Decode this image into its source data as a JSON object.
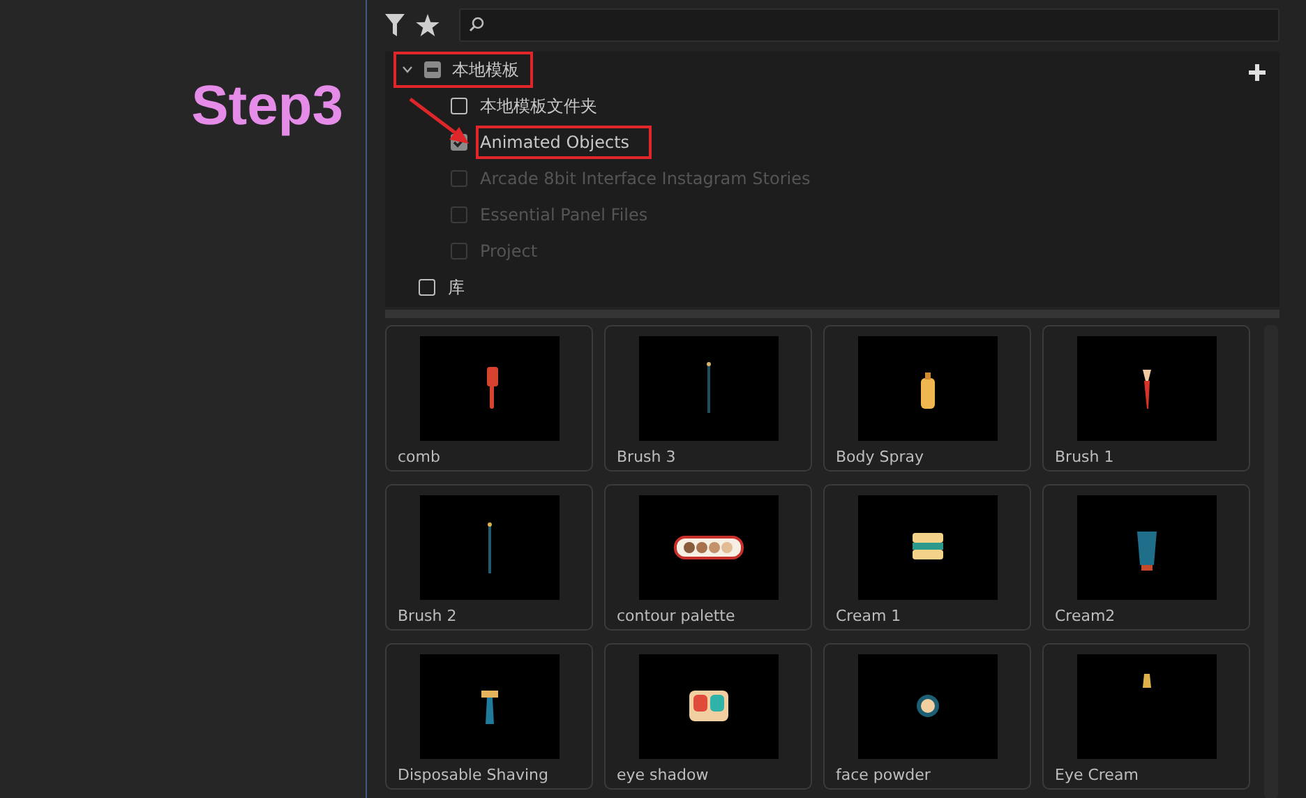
{
  "annotation": {
    "step_label": "Step3"
  },
  "tree": [
    {
      "label": "本地模板",
      "expanded": true,
      "checked": false,
      "partial": true,
      "disabled": false,
      "highlighted": true,
      "children": [
        {
          "label": "本地模板文件夹",
          "checked": false,
          "disabled": false,
          "highlighted": false
        },
        {
          "label": "Animated Objects",
          "checked": true,
          "disabled": false,
          "highlighted": true
        },
        {
          "label": "Arcade 8bit Interface Instagram Stories",
          "checked": false,
          "disabled": true,
          "highlighted": false
        },
        {
          "label": "Essential Panel Files",
          "checked": false,
          "disabled": true,
          "highlighted": false
        },
        {
          "label": "Project",
          "checked": false,
          "disabled": true,
          "highlighted": false
        }
      ]
    },
    {
      "label": "库",
      "checked": false,
      "partial": false,
      "disabled": false,
      "highlighted": false
    }
  ],
  "templates": [
    {
      "name": "comb"
    },
    {
      "name": "Brush 3"
    },
    {
      "name": "Body Spray"
    },
    {
      "name": "Brush 1"
    },
    {
      "name": "Brush 2"
    },
    {
      "name": "contour palette"
    },
    {
      "name": "Cream 1"
    },
    {
      "name": "Cream2"
    },
    {
      "name": "Disposable Shaving"
    },
    {
      "name": "eye shadow"
    },
    {
      "name": "face powder"
    },
    {
      "name": "Eye Cream"
    }
  ]
}
